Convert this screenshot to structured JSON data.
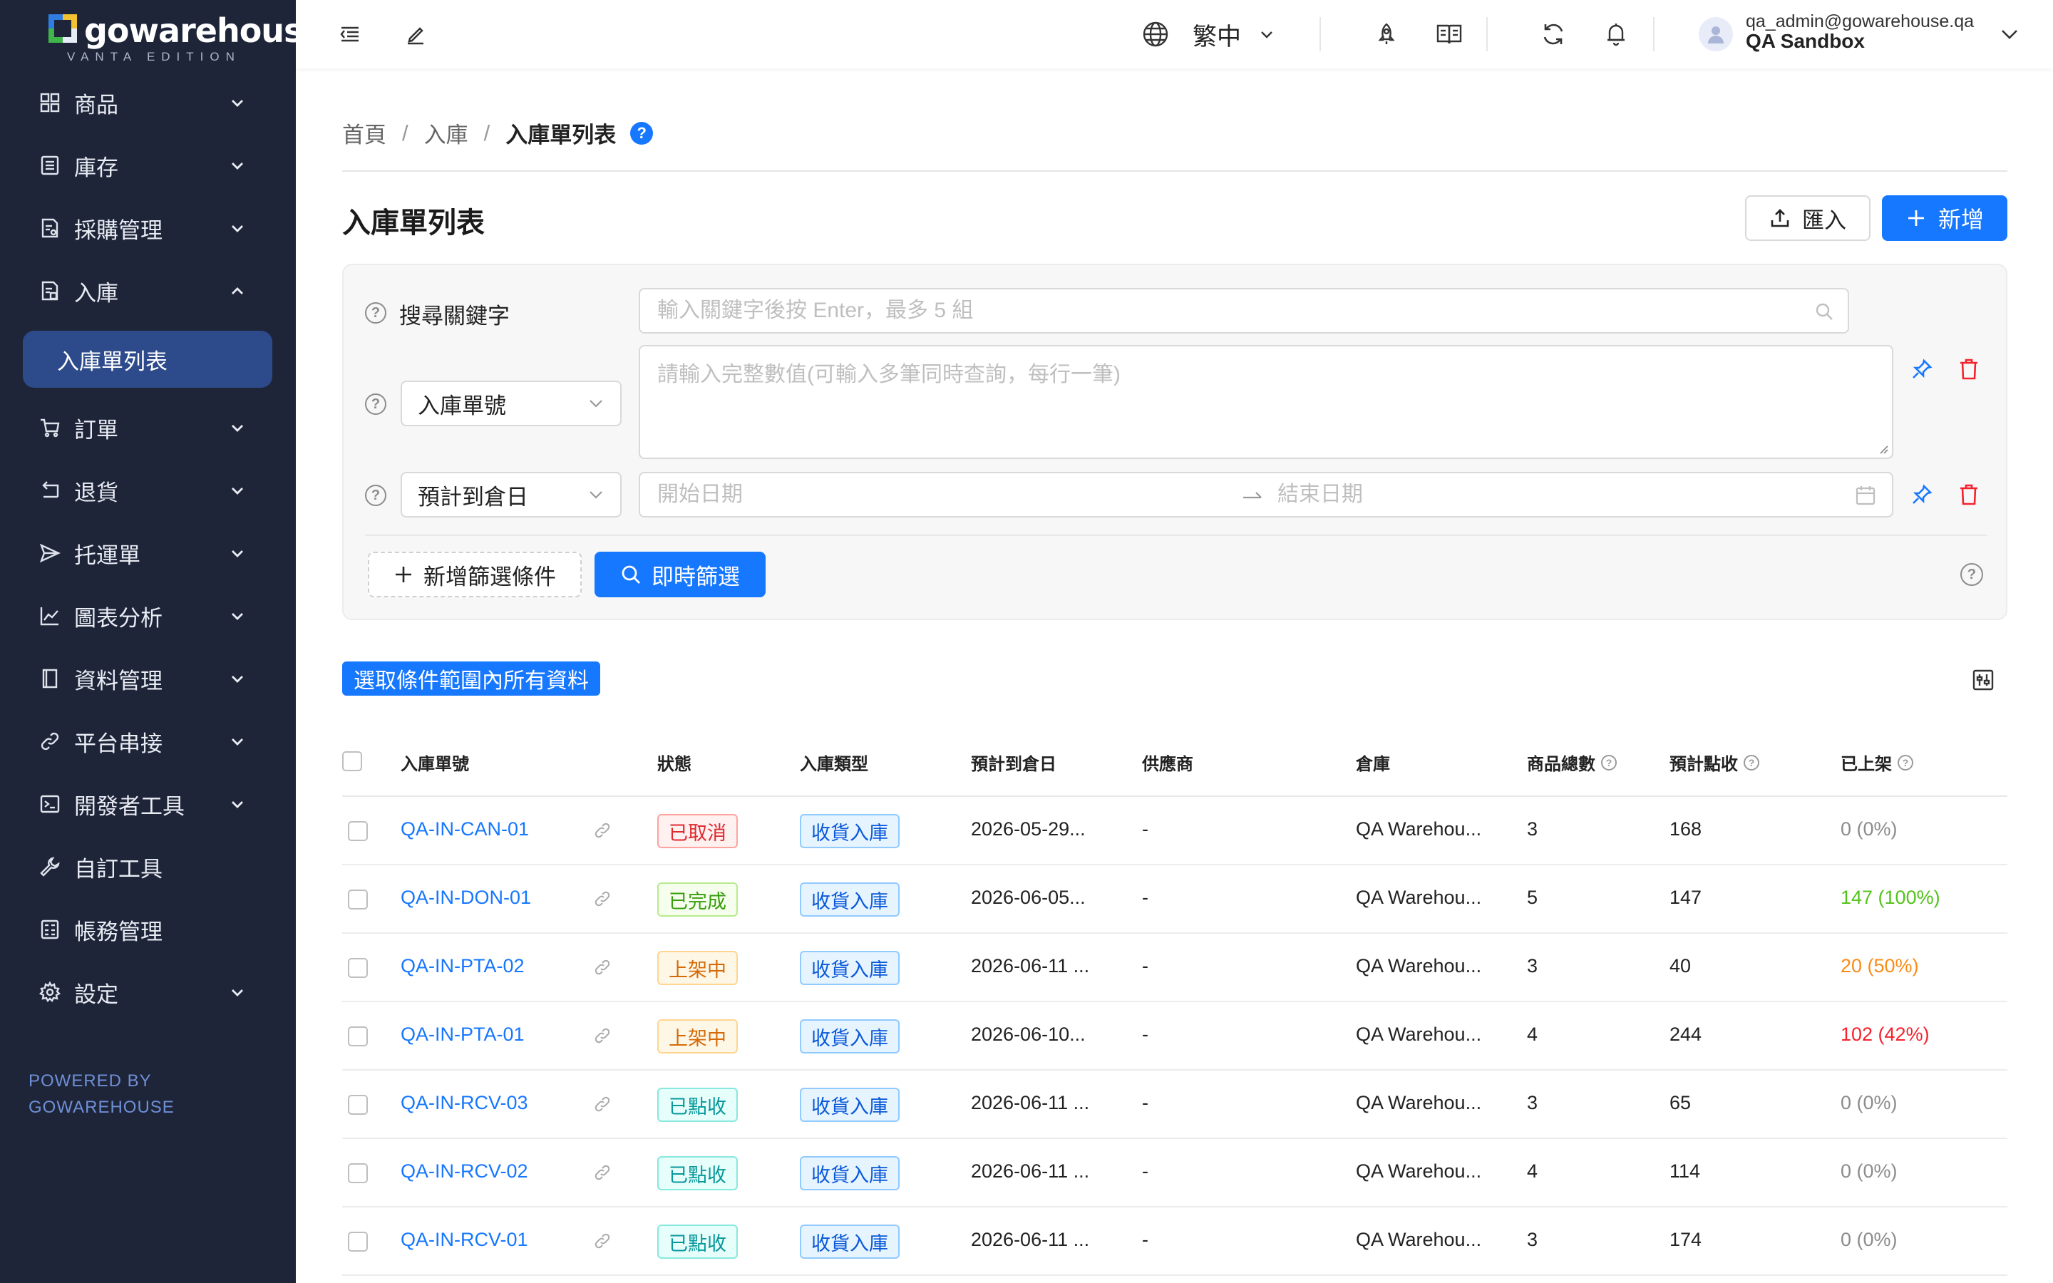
{
  "brand": {
    "name": "gowarehouse",
    "edition": "VANTA EDITION"
  },
  "sidebar": {
    "items": [
      {
        "label": "商品",
        "icon": "grid-icon",
        "expanded": false
      },
      {
        "label": "庫存",
        "icon": "list-icon",
        "expanded": false
      },
      {
        "label": "採購管理",
        "icon": "purchase-doc-icon",
        "expanded": false
      },
      {
        "label": "入庫",
        "icon": "inbound-doc-icon",
        "expanded": true
      },
      {
        "label": "訂單",
        "icon": "cart-icon",
        "expanded": false
      },
      {
        "label": "退貨",
        "icon": "return-icon",
        "expanded": false
      },
      {
        "label": "托運單",
        "icon": "send-icon",
        "expanded": false
      },
      {
        "label": "圖表分析",
        "icon": "line-chart-icon",
        "expanded": false
      },
      {
        "label": "資料管理",
        "icon": "book-icon",
        "expanded": false
      },
      {
        "label": "平台串接",
        "icon": "link-icon",
        "expanded": false
      },
      {
        "label": "開發者工具",
        "icon": "terminal-icon",
        "expanded": false
      },
      {
        "label": "自訂工具",
        "icon": "wrench-icon",
        "expanded": false
      },
      {
        "label": "帳務管理",
        "icon": "calculator-icon",
        "expanded": false
      },
      {
        "label": "設定",
        "icon": "gear-icon",
        "expanded": false
      }
    ],
    "active_sub": "入庫單列表",
    "powered_line1": "POWERED BY",
    "powered_line2": "GOWAREHOUSE"
  },
  "topbar": {
    "language": "繁中",
    "user_email": "qa_admin@gowarehouse.qa",
    "user_org": "QA Sandbox"
  },
  "breadcrumb": {
    "home": "首頁",
    "section": "入庫",
    "current": "入庫單列表",
    "help": "?"
  },
  "page": {
    "title": "入庫單列表",
    "import_label": "匯入",
    "new_label": "新增"
  },
  "filters": {
    "keyword_label": "搜尋關鍵字",
    "keyword_placeholder": "輸入關鍵字後按 Enter，最多 5 組",
    "field1_select": "入庫單號",
    "field1_placeholder": "請輸入完整數值(可輸入多筆同時查詢，每行一筆)",
    "field2_select": "預計到倉日",
    "date_start_placeholder": "開始日期",
    "date_end_placeholder": "結束日期",
    "add_filter_label": "新增篩選條件",
    "search_label": "即時篩選"
  },
  "select_all_label": "選取條件範圍內所有資料",
  "table": {
    "columns": [
      "入庫單號",
      "狀態",
      "入庫類型",
      "預計到倉日",
      "供應商",
      "倉庫",
      "商品總數",
      "預計點收",
      "已上架"
    ],
    "rows": [
      {
        "id": "QA-IN-CAN-01",
        "status": "已取消",
        "status_kind": "cancel",
        "type": "收貨入庫",
        "date": "2026-05-29...",
        "supplier": "-",
        "warehouse": "QA Warehou...",
        "total": "3",
        "expected": "168",
        "shelved": "0 (0%)",
        "shelved_color": "#8c8c8c"
      },
      {
        "id": "QA-IN-DON-01",
        "status": "已完成",
        "status_kind": "done",
        "type": "收貨入庫",
        "date": "2026-06-05...",
        "supplier": "-",
        "warehouse": "QA Warehou...",
        "total": "5",
        "expected": "147",
        "shelved": "147 (100%)",
        "shelved_color": "#52c41a"
      },
      {
        "id": "QA-IN-PTA-02",
        "status": "上架中",
        "status_kind": "shelving",
        "type": "收貨入庫",
        "date": "2026-06-11 ...",
        "supplier": "-",
        "warehouse": "QA Warehou...",
        "total": "3",
        "expected": "40",
        "shelved": "20 (50%)",
        "shelved_color": "#fa8c16"
      },
      {
        "id": "QA-IN-PTA-01",
        "status": "上架中",
        "status_kind": "shelving",
        "type": "收貨入庫",
        "date": "2026-06-10...",
        "supplier": "-",
        "warehouse": "QA Warehou...",
        "total": "4",
        "expected": "244",
        "shelved": "102 (42%)",
        "shelved_color": "#f5222d"
      },
      {
        "id": "QA-IN-RCV-03",
        "status": "已點收",
        "status_kind": "received",
        "type": "收貨入庫",
        "date": "2026-06-11 ...",
        "supplier": "-",
        "warehouse": "QA Warehou...",
        "total": "3",
        "expected": "65",
        "shelved": "0 (0%)",
        "shelved_color": "#8c8c8c"
      },
      {
        "id": "QA-IN-RCV-02",
        "status": "已點收",
        "status_kind": "received",
        "type": "收貨入庫",
        "date": "2026-06-11 ...",
        "supplier": "-",
        "warehouse": "QA Warehou...",
        "total": "4",
        "expected": "114",
        "shelved": "0 (0%)",
        "shelved_color": "#8c8c8c"
      },
      {
        "id": "QA-IN-RCV-01",
        "status": "已點收",
        "status_kind": "received",
        "type": "收貨入庫",
        "date": "2026-06-11 ...",
        "supplier": "-",
        "warehouse": "QA Warehou...",
        "total": "3",
        "expected": "174",
        "shelved": "0 (0%)",
        "shelved_color": "#8c8c8c"
      }
    ]
  },
  "colors": {
    "accent": "#1677ff",
    "sidebar_bg": "#1e2539",
    "sidebar_active": "#2d4a8a",
    "danger": "#f5222d"
  }
}
